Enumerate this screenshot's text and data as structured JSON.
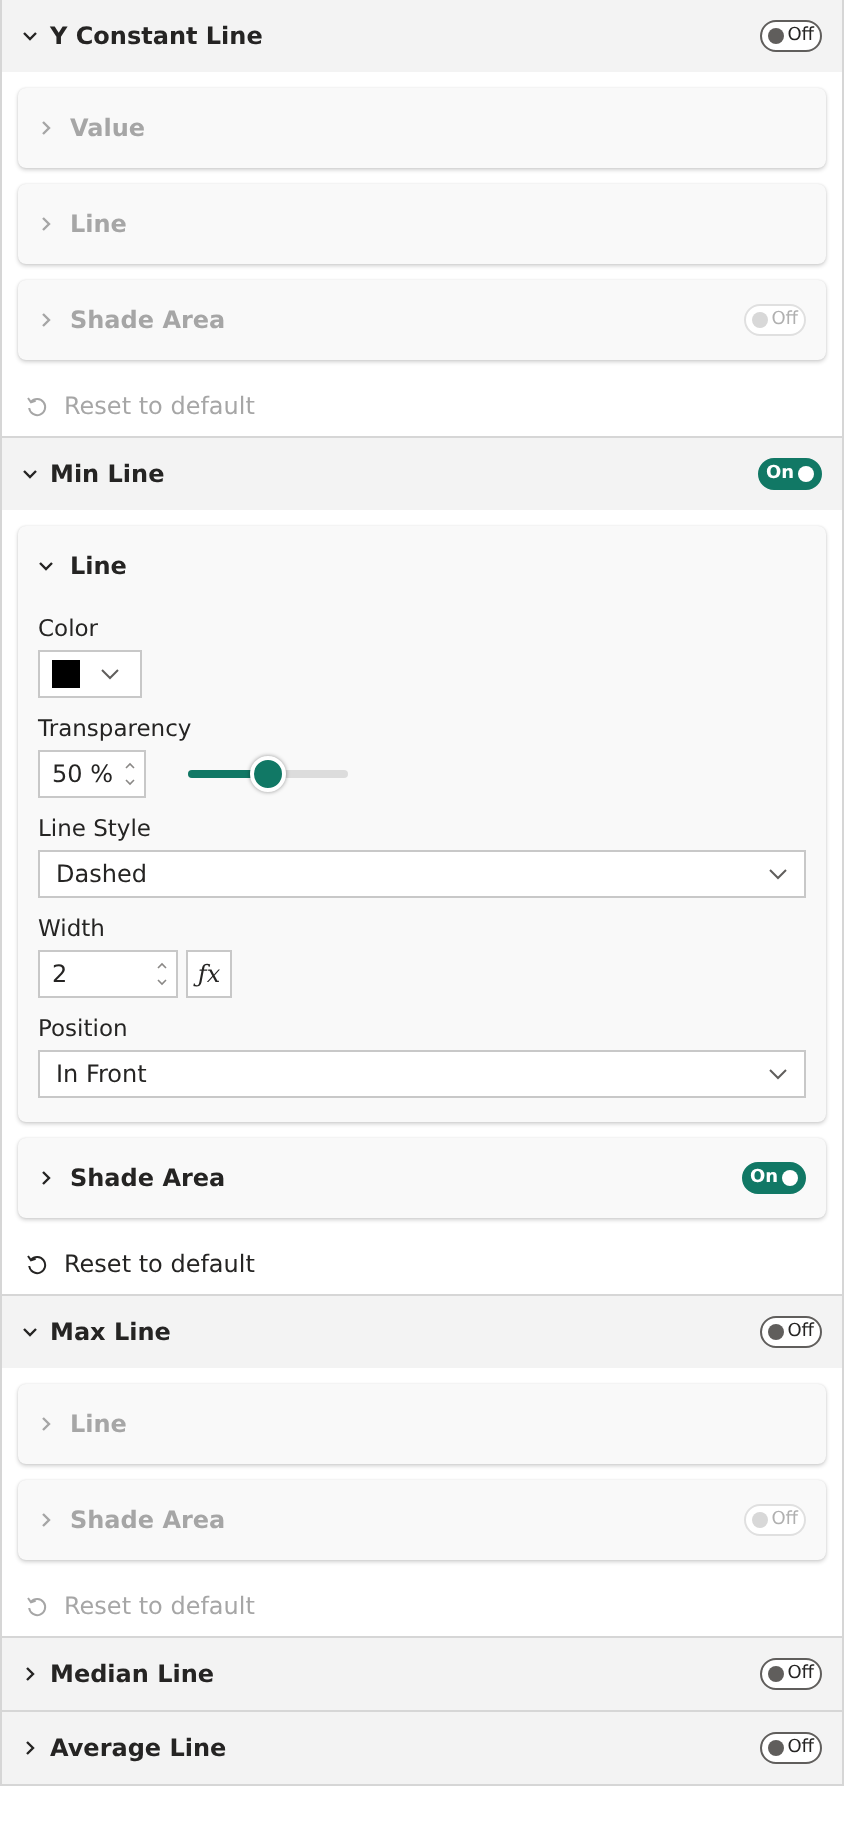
{
  "sections": [
    {
      "title": "Y Constant Line",
      "expanded": true,
      "toggle": {
        "label": "Off",
        "on": false
      },
      "cards": [
        {
          "title": "Value",
          "expanded": false,
          "disabled": true
        },
        {
          "title": "Line",
          "expanded": false,
          "disabled": true
        },
        {
          "title": "Shade Area",
          "expanded": false,
          "disabled": true,
          "toggle": {
            "label": "Off",
            "on": false
          }
        }
      ],
      "reset": {
        "label": "Reset to default",
        "disabled": true
      }
    },
    {
      "title": "Min Line",
      "expanded": true,
      "toggle": {
        "label": "On",
        "on": true
      },
      "cards": [
        {
          "title": "Line",
          "expanded": true,
          "disabled": false,
          "fields": [
            {
              "kind": "color",
              "label": "Color",
              "color": "#000000"
            },
            {
              "kind": "slider",
              "label": "Transparency",
              "value": "50 %",
              "level": 0.5
            },
            {
              "kind": "dropdown",
              "label": "Line Style",
              "value": "Dashed"
            },
            {
              "kind": "number",
              "label": "Width",
              "value": "2",
              "fx": "ƒx"
            },
            {
              "kind": "dropdown",
              "label": "Position",
              "value": "In Front"
            }
          ]
        },
        {
          "title": "Shade Area",
          "expanded": false,
          "disabled": false,
          "toggle": {
            "label": "On",
            "on": true
          }
        }
      ],
      "reset": {
        "label": "Reset to default",
        "disabled": false
      }
    },
    {
      "title": "Max Line",
      "expanded": true,
      "toggle": {
        "label": "Off",
        "on": false
      },
      "cards": [
        {
          "title": "Line",
          "expanded": false,
          "disabled": true
        },
        {
          "title": "Shade Area",
          "expanded": false,
          "disabled": true,
          "toggle": {
            "label": "Off",
            "on": false
          }
        }
      ],
      "reset": {
        "label": "Reset to default",
        "disabled": true
      }
    },
    {
      "title": "Median Line",
      "expanded": false,
      "toggle": {
        "label": "Off",
        "on": false
      }
    },
    {
      "title": "Average Line",
      "expanded": false,
      "toggle": {
        "label": "Off",
        "on": false
      }
    }
  ]
}
